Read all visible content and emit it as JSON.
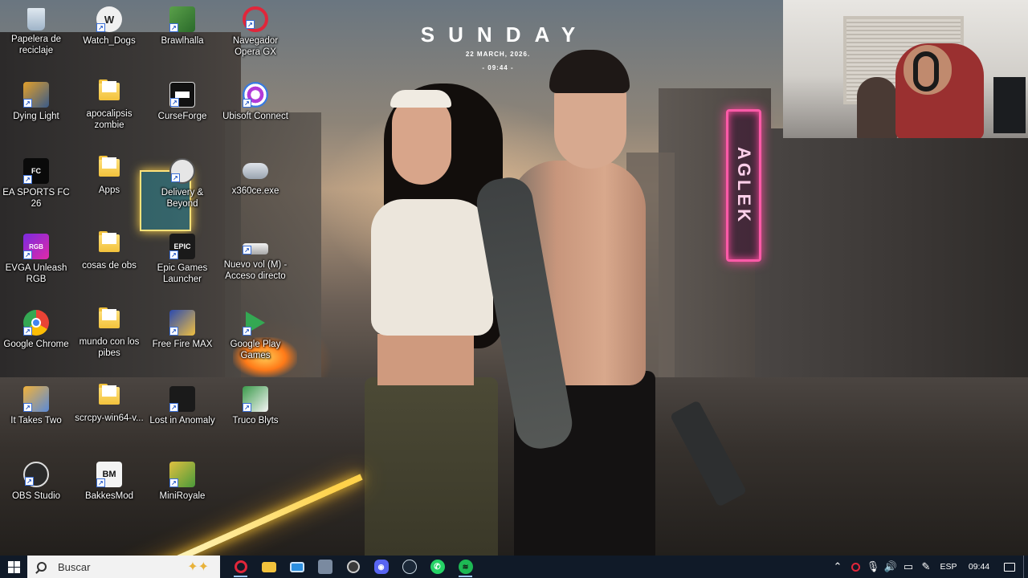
{
  "wallpaper": {
    "day_name": "SUNDAY",
    "date": "22 MARCH, 2026.",
    "time": "- 09:44 -",
    "neon_text": "AGLEK"
  },
  "desktop_icons": [
    {
      "label": "Papelera de reciclaje",
      "icon": "recycle-bin-icon"
    },
    {
      "label": "Dying Light",
      "icon": "dying-light-icon"
    },
    {
      "label": "EA SPORTS FC 26",
      "icon": "ea-fc-icon"
    },
    {
      "label": "EVGA Unleash RGB",
      "icon": "evga-rgb-icon"
    },
    {
      "label": "Google Chrome",
      "icon": "chrome-icon"
    },
    {
      "label": "It Takes Two",
      "icon": "it-takes-two-icon"
    },
    {
      "label": "OBS Studio",
      "icon": "obs-icon"
    },
    {
      "label": "Watch_Dogs",
      "icon": "watch-dogs-icon"
    },
    {
      "label": "apocalipsis zombie",
      "icon": "folder-icon"
    },
    {
      "label": "Apps",
      "icon": "folder-icon"
    },
    {
      "label": "cosas de obs",
      "icon": "folder-icon"
    },
    {
      "label": "mundo con los pibes",
      "icon": "folder-icon"
    },
    {
      "label": "scrcpy-win64-v...",
      "icon": "folder-icon"
    },
    {
      "label": "BakkesMod",
      "icon": "bakkesmod-icon"
    },
    {
      "label": "Brawlhalla",
      "icon": "brawlhalla-icon"
    },
    {
      "label": "CurseForge",
      "icon": "curseforge-icon"
    },
    {
      "label": "Delivery & Beyond",
      "icon": "delivery-beyond-icon"
    },
    {
      "label": "Epic Games Launcher",
      "icon": "epic-games-icon"
    },
    {
      "label": "Free Fire MAX",
      "icon": "free-fire-icon"
    },
    {
      "label": "Lost in Anomaly",
      "icon": "lost-in-anomaly-icon"
    },
    {
      "label": "MiniRoyale",
      "icon": "miniroyale-icon"
    },
    {
      "label": "Navegador Opera GX",
      "icon": "opera-gx-icon"
    },
    {
      "label": "Ubisoft Connect",
      "icon": "ubisoft-icon"
    },
    {
      "label": "x360ce.exe",
      "icon": "gamepad-icon"
    },
    {
      "label": "Nuevo vol (M) - Acceso directo",
      "icon": "drive-icon"
    },
    {
      "label": "Google Play Games",
      "icon": "google-play-games-icon"
    },
    {
      "label": "Truco Blyts",
      "icon": "truco-icon"
    }
  ],
  "taskbar": {
    "search_placeholder": "Buscar",
    "apps": [
      {
        "name": "opera-gx-taskbar-icon",
        "color": "#e0263a"
      },
      {
        "name": "file-explorer-icon",
        "color": "#f2c23c"
      },
      {
        "name": "desktop-app-icon",
        "color": "#2d8fe0"
      },
      {
        "name": "remote-app-icon",
        "color": "#7a8aa0"
      },
      {
        "name": "obs-taskbar-icon",
        "color": "#3a3a3a"
      },
      {
        "name": "discord-icon",
        "color": "#5865f2"
      },
      {
        "name": "steam-icon",
        "color": "#1b2838"
      },
      {
        "name": "whatsapp-icon",
        "color": "#25d366"
      },
      {
        "name": "spotify-icon",
        "color": "#1db954"
      }
    ],
    "language": "ESP",
    "clock": "09:44"
  }
}
